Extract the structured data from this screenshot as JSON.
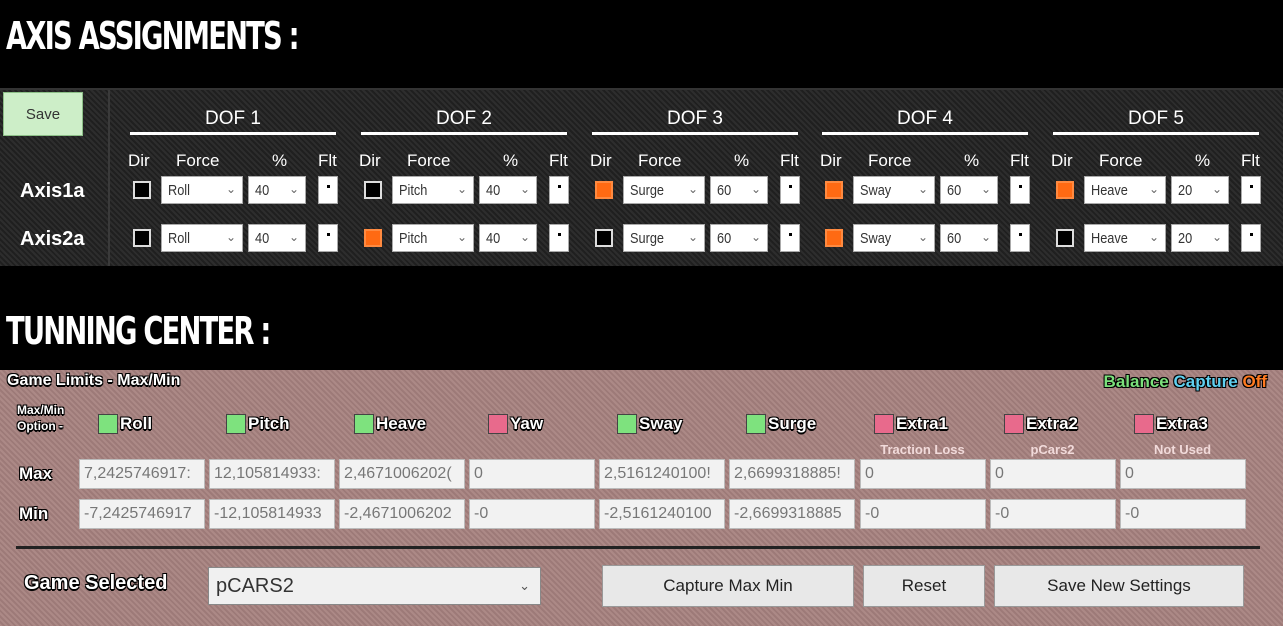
{
  "headings": {
    "axis": "AXIS ASSIGNMENTS :",
    "tuning": "TUNNING CENTER :"
  },
  "axis": {
    "save_label": "Save",
    "column_headers": {
      "dir": "Dir",
      "force": "Force",
      "percent": "%",
      "flt": "Flt"
    },
    "dofs": [
      "DOF 1",
      "DOF 2",
      "DOF 3",
      "DOF 4",
      "DOF 5"
    ],
    "rows": [
      {
        "label": "Axis1a",
        "cells": [
          {
            "dir": false,
            "force": "Roll",
            "percent": "40"
          },
          {
            "dir": false,
            "force": "Pitch",
            "percent": "40"
          },
          {
            "dir": true,
            "force": "Surge",
            "percent": "60"
          },
          {
            "dir": true,
            "force": "Sway",
            "percent": "60"
          },
          {
            "dir": true,
            "force": "Heave",
            "percent": "20"
          }
        ]
      },
      {
        "label": "Axis2a",
        "cells": [
          {
            "dir": false,
            "force": "Roll",
            "percent": "40"
          },
          {
            "dir": true,
            "force": "Pitch",
            "percent": "40"
          },
          {
            "dir": false,
            "force": "Surge",
            "percent": "60"
          },
          {
            "dir": true,
            "force": "Sway",
            "percent": "60"
          },
          {
            "dir": false,
            "force": "Heave",
            "percent": "20"
          }
        ]
      }
    ]
  },
  "tuning": {
    "title": "Game Limits - Max/Min",
    "balance": {
      "word1": "Balance",
      "word2": "Capture",
      "word3": "Off"
    },
    "option_label_1": "Max/Min",
    "option_label_2": "Option -",
    "options": [
      {
        "label": "Roll",
        "color": "#7ee27e",
        "sub": ""
      },
      {
        "label": "Pitch",
        "color": "#7ee27e",
        "sub": ""
      },
      {
        "label": "Heave",
        "color": "#7ee27e",
        "sub": ""
      },
      {
        "label": "Yaw",
        "color": "#e86a8c",
        "sub": ""
      },
      {
        "label": "Sway",
        "color": "#7ee27e",
        "sub": ""
      },
      {
        "label": "Surge",
        "color": "#7ee27e",
        "sub": ""
      },
      {
        "label": "Extra1",
        "color": "#e86a8c",
        "sub": "Traction Loss"
      },
      {
        "label": "Extra2",
        "color": "#e86a8c",
        "sub": "pCars2"
      },
      {
        "label": "Extra3",
        "color": "#e86a8c",
        "sub": "Not Used"
      }
    ],
    "max_label": "Max",
    "min_label": "Min",
    "max_values": [
      "7,2425746917:",
      "12,105814933:",
      "2,4671006202(",
      "0",
      "2,5161240100!",
      "2,6699318885!",
      "0",
      "0",
      "0"
    ],
    "min_values": [
      "-7,2425746917",
      "-12,105814933",
      "-2,4671006202",
      "-0",
      "-2,5161240100",
      "-2,6699318885",
      "-0",
      "-0",
      "-0"
    ],
    "game_selected_label": "Game Selected",
    "game_selected_value": "pCARS2",
    "buttons": {
      "capture": "Capture Max Min",
      "reset": "Reset",
      "save": "Save New Settings"
    }
  }
}
